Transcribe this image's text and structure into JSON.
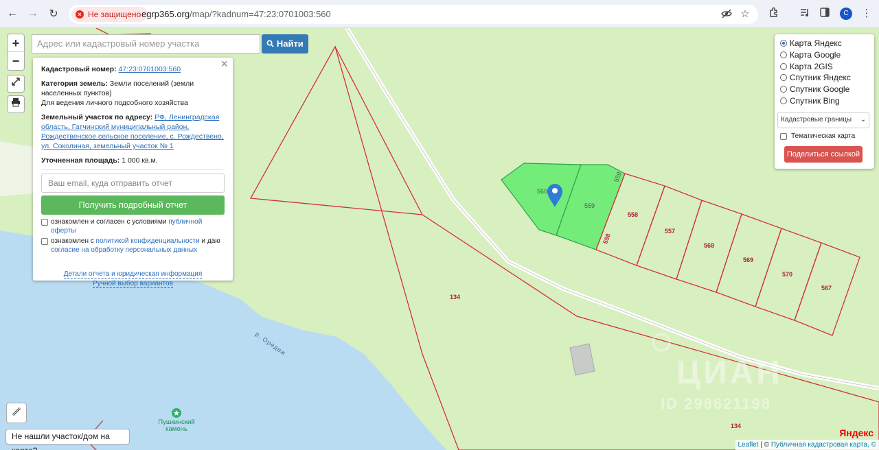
{
  "browser": {
    "security_label": "Не защищено",
    "url_host": "egrp365.org",
    "url_path": "/map/?kadnum=47:23:0701003:560",
    "profile_initial": "С"
  },
  "search": {
    "placeholder": "Адрес или кадастровый номер участка",
    "button_label": "Найти"
  },
  "zoom": {
    "in_label": "+",
    "out_label": "−"
  },
  "info": {
    "cadastral_label": "Кадастровый номер:",
    "cadastral_value": "47:23:0701003:560",
    "category_label": "Категория земель:",
    "category_value": "Земли поселений (земли населенных пунктов)",
    "usage": "Для ведения личного подсобного хозяйства",
    "address_label": "Земельный участок по адресу:",
    "address_value": "РФ, Ленинградская область, Гатчинский муниципальный район, Рождественское сельское поселение, с. Рождествено, ул. Соколиная, земельный участок № 1",
    "area_label": "Уточненная площадь:",
    "area_value": "1 000 кв.м.",
    "email_placeholder": "Ваш email, куда отправить отчет",
    "report_button": "Получить подробный отчет",
    "consent1_text": "ознакомлен и согласен с условиями",
    "consent1_link": "публичной оферты",
    "consent2_text_a": "ознакомлен с",
    "consent2_link_a": "политикой конфиденциальности",
    "consent2_text_b": "и даю",
    "consent2_link_b": "согласие на обработку персональных данных",
    "details_link": "Детали отчета и юридическая информация",
    "manual_link": "Ручной выбор вариантов",
    "close_label": "×"
  },
  "layers": {
    "options": [
      {
        "label": "Карта Яндекс",
        "selected": true
      },
      {
        "label": "Карта Google",
        "selected": false
      },
      {
        "label": "Карта 2GIS",
        "selected": false
      },
      {
        "label": "Спутник Яндекс",
        "selected": false
      },
      {
        "label": "Спутник Google",
        "selected": false
      },
      {
        "label": "Спутник Bing",
        "selected": false
      }
    ],
    "select_value": "Кадастровые границы",
    "thematic_label": "Тематическая карта",
    "share_button": "Поделиться ссылкой"
  },
  "map": {
    "parcel_labels": [
      "560",
      "559",
      "559",
      "558",
      "558",
      "557",
      "568",
      "569",
      "570",
      "567",
      "134",
      "134"
    ],
    "river_label": "р. Оредеж",
    "poi_label": "Пушкинский камень",
    "watermark": "ЦИАН",
    "watermark_id": "ID 298621198"
  },
  "notfound_button": "Не нашли участок/дом на карте?",
  "attribution": {
    "leaflet": "Leaflet",
    "separator": "| ©",
    "pkk": "Публичная кадастровая карта, ©"
  },
  "yandex_logo": "Яндекс",
  "colors": {
    "land": "#d8efc0",
    "water": "#b9dcf2",
    "selected_parcel": "#73ec7a",
    "boundary": "#d4313a",
    "search_button": "#337ab7",
    "report_button": "#5cb85c",
    "share_button": "#d9534f"
  }
}
